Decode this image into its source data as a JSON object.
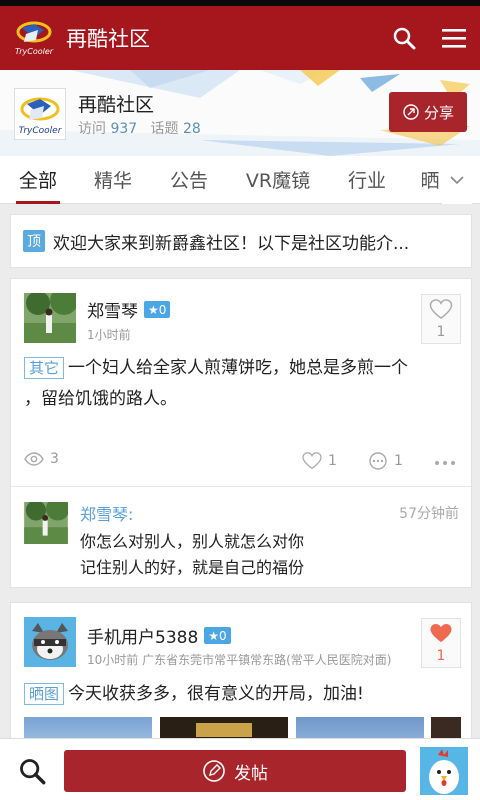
{
  "appbar": {
    "title": "再酷社区",
    "logo_text": "TryCooler"
  },
  "community": {
    "name": "再酷社区",
    "visits_label": "访问",
    "visits": "937",
    "topics_label": "话题",
    "topics": "28",
    "share_label": "分享"
  },
  "tabs": [
    {
      "label": "全部",
      "active": true
    },
    {
      "label": "精华"
    },
    {
      "label": "公告"
    },
    {
      "label": "VR魔镜"
    },
    {
      "label": "行业"
    },
    {
      "label": "晒"
    }
  ],
  "notice": {
    "tag": "顶",
    "text": "欢迎大家来到新爵鑫社区！以下是社区功能介..."
  },
  "post1": {
    "author": "郑雪琴",
    "level": "0",
    "time": "1小时前",
    "likes": "1",
    "category": "其它",
    "line1": "一个妇人给全家人煎薄饼吃，她总是多煎一个",
    "line2": "，留给饥饿的路人。",
    "views": "3",
    "like_count": "1",
    "comment_count": "1",
    "reply": {
      "author": "郑雪琴:",
      "time": "57分钟前",
      "line1": "你怎么对别人，别人就怎么对你",
      "line2": "记住别人的好，就是自己的福份"
    }
  },
  "post2": {
    "author": "手机用户5388",
    "level": "0",
    "time": "10小时前",
    "location": "广东省东莞市常平镇常东路(常平人民医院对面)",
    "likes": "1",
    "category": "晒图",
    "text": "今天收获多多，很有意义的开局，加油!"
  },
  "bottombar": {
    "post_label": "发帖"
  },
  "colors": {
    "primary": "#a5161d",
    "accent_blue": "#4aa6e4"
  }
}
